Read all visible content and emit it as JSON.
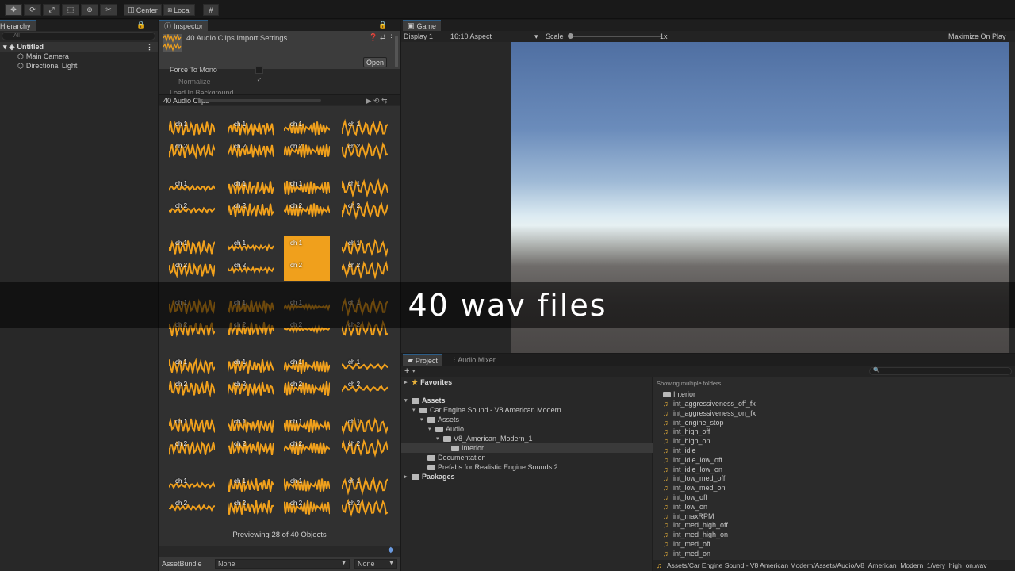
{
  "toolbar": {
    "pivot_center": "Center",
    "pivot_local": "Local"
  },
  "hierarchy": {
    "tab": "Hierarchy",
    "search_placeholder": "All",
    "scene": "Untitled",
    "items": [
      "Main Camera",
      "Directional Light"
    ]
  },
  "inspector": {
    "tab": "Inspector",
    "title": "40 Audio Clips Import Settings",
    "open_label": "Open",
    "force_to_mono": "Force To Mono",
    "normalize": "Normalize",
    "load_in_background": "Load In Background",
    "normalize_check": "✓",
    "clips_title": "40 Audio Clips",
    "ch1": "ch 1",
    "ch2": "ch 2",
    "preview_text": "Previewing 28 of 40 Objects",
    "asset_bundle_label": "AssetBundle",
    "asset_bundle_value": "None",
    "asset_variant_value": "None"
  },
  "game": {
    "tab": "Game",
    "display": "Display 1",
    "aspect": "16:10 Aspect",
    "scale_label": "Scale",
    "scale_value": "1x",
    "maximize": "Maximize On Play"
  },
  "project": {
    "tab_project": "Project",
    "tab_mixer": "Audio Mixer",
    "add": "+",
    "showing": "Showing multiple folders...",
    "tree": [
      {
        "label": "Favorites",
        "indent": 0,
        "bold": true,
        "icon": "star"
      },
      {
        "label": "Assets",
        "indent": 0,
        "bold": true,
        "icon": "folder"
      },
      {
        "label": "Car Engine Sound - V8 American Modern",
        "indent": 1,
        "icon": "folder"
      },
      {
        "label": "Assets",
        "indent": 2,
        "icon": "folder"
      },
      {
        "label": "Audio",
        "indent": 3,
        "icon": "folder"
      },
      {
        "label": "V8_American_Modern_1",
        "indent": 4,
        "icon": "folder"
      },
      {
        "label": "Interior",
        "indent": 5,
        "icon": "folder",
        "selected": true
      },
      {
        "label": "Documentation",
        "indent": 2,
        "icon": "folder"
      },
      {
        "label": "Prefabs for Realistic Engine Sounds 2",
        "indent": 2,
        "icon": "folder"
      },
      {
        "label": "Packages",
        "indent": 0,
        "bold": true,
        "icon": "folder"
      }
    ],
    "folder": "Interior",
    "files": [
      "int_aggressiveness_off_fx",
      "int_aggressiveness_on_fx",
      "int_engine_stop",
      "int_high_off",
      "int_high_on",
      "int_idle",
      "int_idle_low_off",
      "int_idle_low_on",
      "int_low_med_off",
      "int_low_med_on",
      "int_low_off",
      "int_low_on",
      "int_maxRPM",
      "int_med_high_off",
      "int_med_high_on",
      "int_med_off",
      "int_med_on"
    ],
    "path": "Assets/Car Engine Sound - V8 American Modern/Assets/Audio/V8_American_Modern_1/very_high_on.wav"
  },
  "caption": "40 wav files",
  "colors": {
    "waveform": "#f0a01c",
    "accent_tab": "#2c5d87",
    "folder_note": "#e8b13a"
  }
}
